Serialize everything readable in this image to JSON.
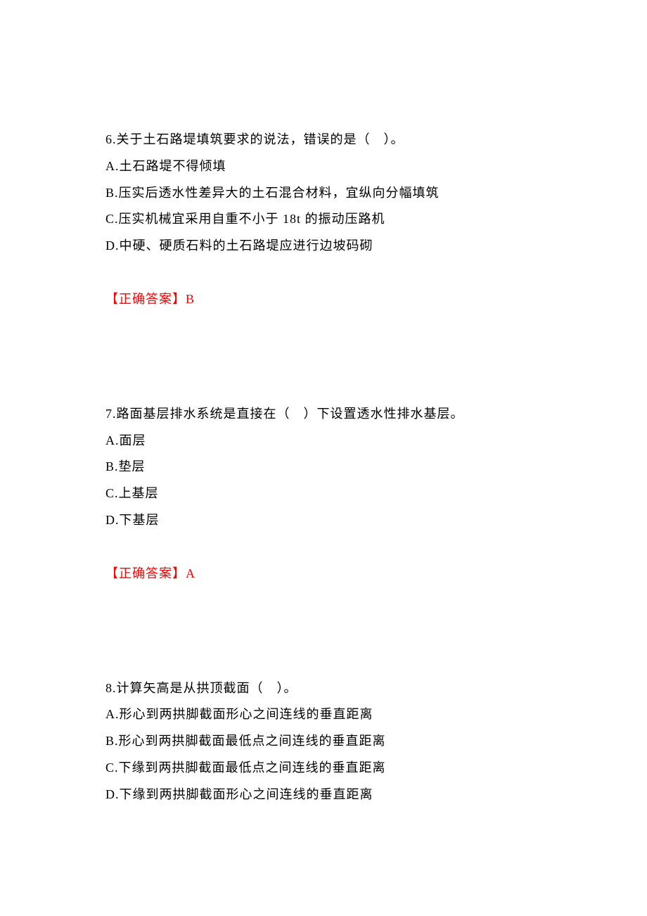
{
  "questions": [
    {
      "number": "6.",
      "stem": "关于土石路堤填筑要求的说法，错误的是（　）。",
      "options": [
        "A.土石路堤不得倾填",
        "B.压实后透水性差异大的土石混合材料，宜纵向分幅填筑",
        "C.压实机械宜采用自重不小于 18t 的振动压路机",
        "D.中硬、硬质石料的土石路堤应进行边坡码砌"
      ],
      "answer_label": "【正确答案】",
      "answer_value": "B"
    },
    {
      "number": "7.",
      "stem": "路面基层排水系统是直接在（　）下设置透水性排水基层。",
      "options": [
        "A.面层",
        "B.垫层",
        "C.上基层",
        "D.下基层"
      ],
      "answer_label": "【正确答案】",
      "answer_value": "A"
    },
    {
      "number": "8.",
      "stem": "计算矢高是从拱顶截面（　）。",
      "options": [
        "A.形心到两拱脚截面形心之间连线的垂直距离",
        "B.形心到两拱脚截面最低点之间连线的垂直距离",
        "C.下缘到两拱脚截面最低点之间连线的垂直距离",
        "D.下缘到两拱脚截面形心之间连线的垂直距离"
      ],
      "answer_label": "",
      "answer_value": ""
    }
  ]
}
